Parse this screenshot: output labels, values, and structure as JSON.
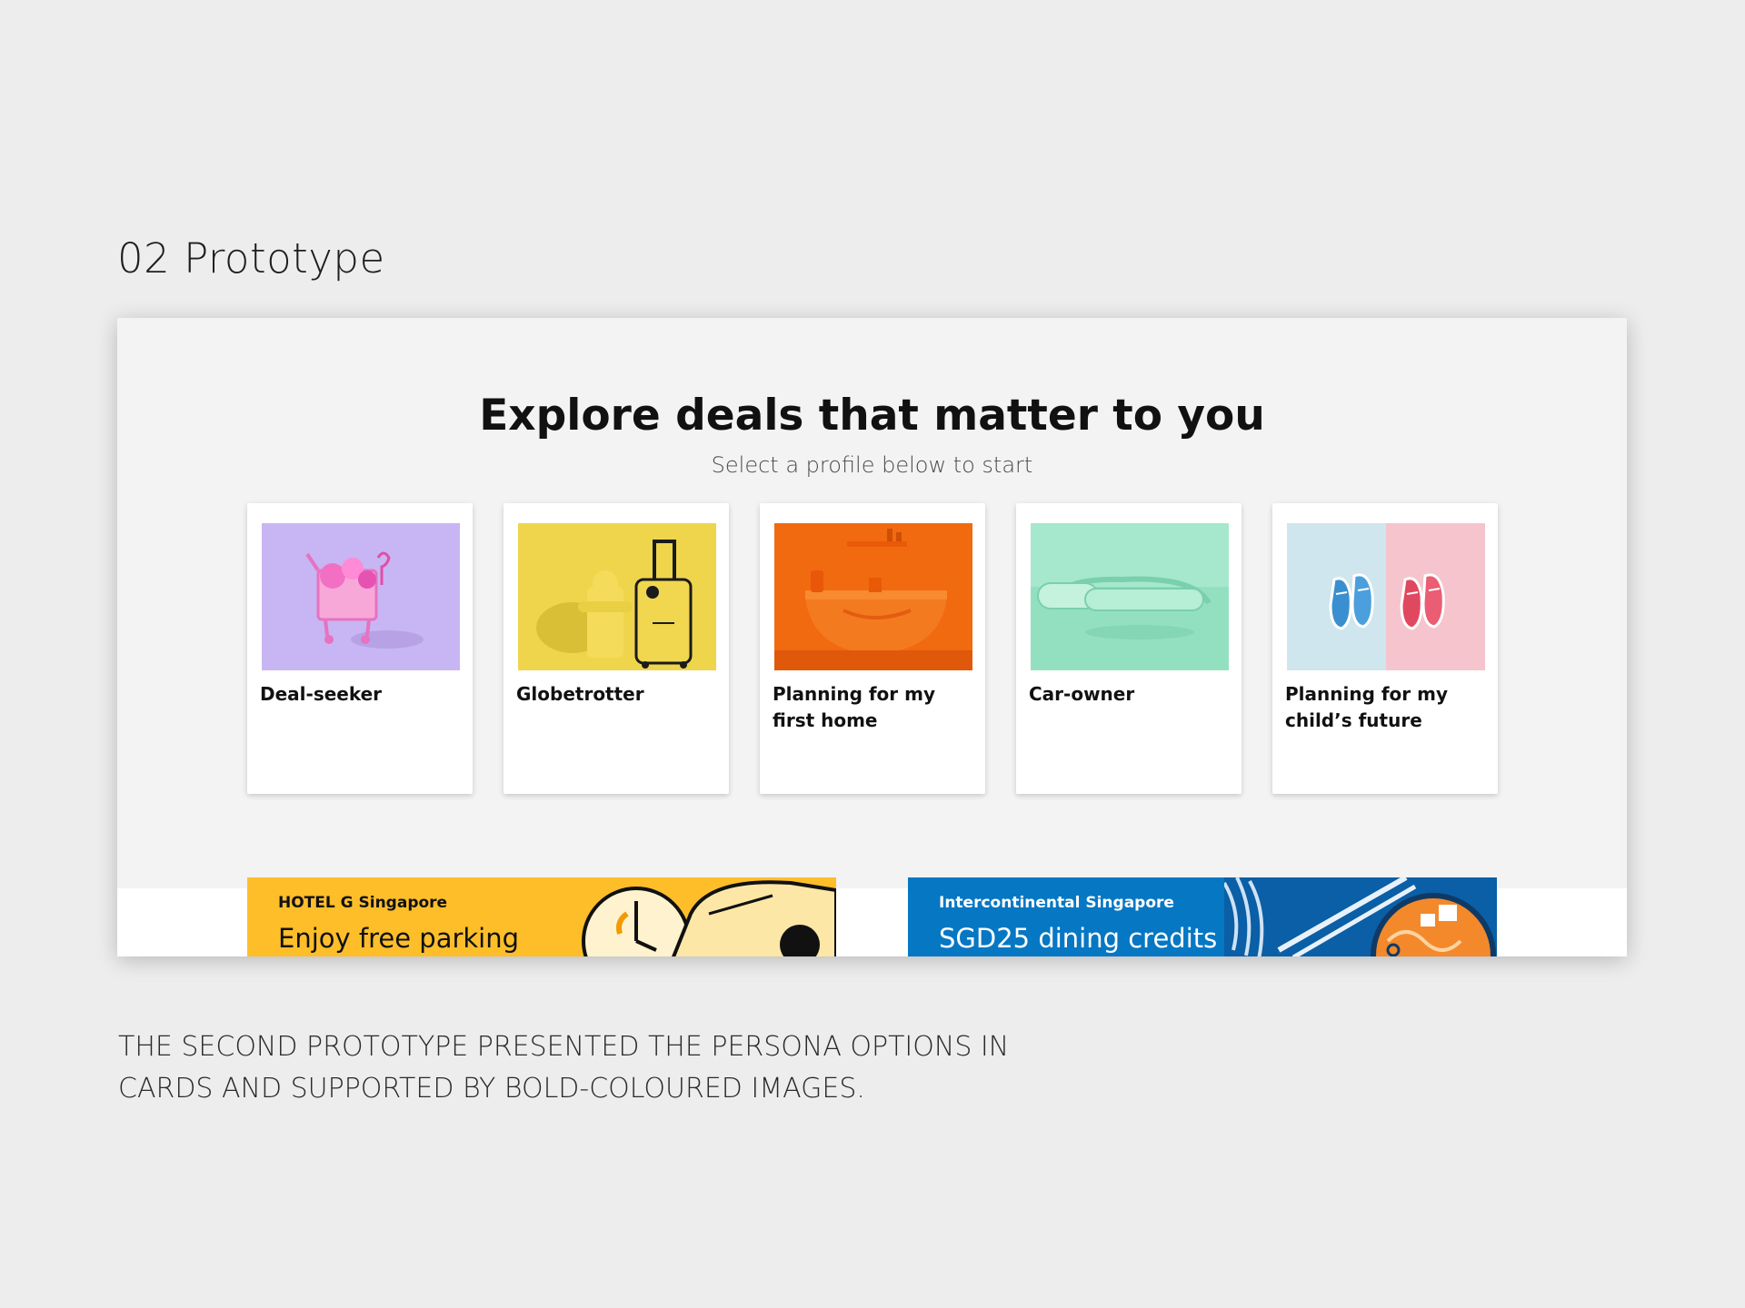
{
  "section_title": "02 Prototype",
  "hero": {
    "title": "Explore deals that matter to you",
    "subtitle": "Select a profile below to start"
  },
  "cards": [
    {
      "label": "Deal-seeker",
      "icon": "shopping-cart-image",
      "bg": "#c7b6f3"
    },
    {
      "label": "Globetrotter",
      "icon": "luggage-image",
      "bg": "#eed54c"
    },
    {
      "label": "Planning for my first home",
      "icon": "sink-image",
      "bg": "#f26a10"
    },
    {
      "label": "Car-owner",
      "icon": "car-door-handle-image",
      "bg": "#93e0c1"
    },
    {
      "label": "Planning for my child’s future",
      "icon": "baby-shoes-image",
      "bg": "#cfe6ee"
    }
  ],
  "banners": [
    {
      "brand": "HOTEL G Singapore",
      "offer": "Enjoy free parking",
      "color": "#fdbe2a"
    },
    {
      "brand": "Intercontinental Singapore",
      "offer": "SGD25 dining credits",
      "color": "#0677c3"
    }
  ],
  "caption": {
    "line1": "THE SECOND PROTOTYPE PRESENTED THE PERSONA OPTIONS IN",
    "line2": "CARDS AND SUPPORTED BY BOLD-COLOURED IMAGES."
  }
}
